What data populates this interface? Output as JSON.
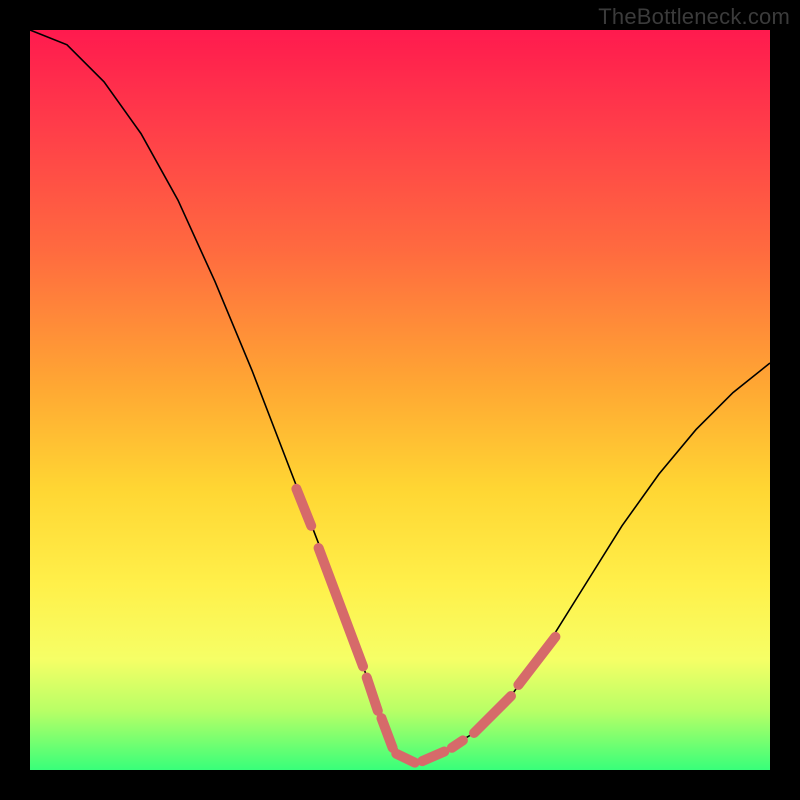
{
  "watermark": "TheBottleneck.com",
  "chart_data": {
    "type": "line",
    "title": "",
    "xlabel": "",
    "ylabel": "",
    "xlim": [
      0,
      100
    ],
    "ylim": [
      0,
      100
    ],
    "grid": false,
    "legend": false,
    "series": [
      {
        "name": "curve",
        "stroke": "#000000",
        "x": [
          0,
          5,
          10,
          15,
          20,
          25,
          30,
          35,
          40,
          45,
          48,
          50,
          52,
          55,
          60,
          65,
          70,
          75,
          80,
          85,
          90,
          95,
          100
        ],
        "y": [
          100,
          98,
          93,
          86,
          77,
          66,
          54,
          41,
          28,
          14,
          6,
          2,
          1,
          2,
          5,
          10,
          17,
          25,
          33,
          40,
          46,
          51,
          55
        ]
      }
    ],
    "highlight_segments": {
      "stroke": "#d66a6a",
      "stroke_width": 10,
      "segments": [
        {
          "x1": 36,
          "y1": 38,
          "x2": 38,
          "y2": 33
        },
        {
          "x1": 39,
          "y1": 30,
          "x2": 45,
          "y2": 14
        },
        {
          "x1": 45.5,
          "y1": 12.5,
          "x2": 47,
          "y2": 8
        },
        {
          "x1": 47.5,
          "y1": 7,
          "x2": 49,
          "y2": 3
        },
        {
          "x1": 49.5,
          "y1": 2.2,
          "x2": 52,
          "y2": 1
        },
        {
          "x1": 53,
          "y1": 1.2,
          "x2": 56,
          "y2": 2.5
        },
        {
          "x1": 57,
          "y1": 3,
          "x2": 58.5,
          "y2": 4
        },
        {
          "x1": 60,
          "y1": 5,
          "x2": 65,
          "y2": 10
        },
        {
          "x1": 66,
          "y1": 11.5,
          "x2": 71,
          "y2": 18
        }
      ]
    }
  }
}
